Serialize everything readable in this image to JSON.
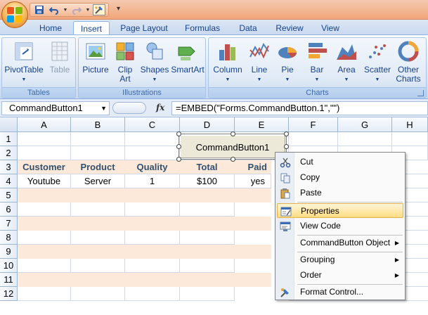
{
  "qat": {
    "save_icon": "save-icon",
    "undo_icon": "undo-icon",
    "redo_icon": "redo-icon",
    "design_mode_icon": "design-mode-icon",
    "more": "▾"
  },
  "tabs": [
    {
      "label": "Home"
    },
    {
      "label": "Insert"
    },
    {
      "label": "Page Layout"
    },
    {
      "label": "Formulas"
    },
    {
      "label": "Data"
    },
    {
      "label": "Review"
    },
    {
      "label": "View"
    }
  ],
  "ribbon": {
    "tables": {
      "label": "Tables",
      "pivot": "PivotTable",
      "table": "Table"
    },
    "illustrations": {
      "label": "Illustrations",
      "picture": "Picture",
      "clipart_1": "Clip",
      "clipart_2": "Art",
      "shapes": "Shapes",
      "smartart": "SmartArt"
    },
    "charts": {
      "label": "Charts",
      "column": "Column",
      "line": "Line",
      "pie": "Pie",
      "bar": "Bar",
      "area": "Area",
      "scatter": "Scatter",
      "other_1": "Other",
      "other_2": "Charts"
    }
  },
  "formula_bar": {
    "name_box": "CommandButton1",
    "fx": "fx",
    "formula": "=EMBED(\"Forms.CommandButton.1\",\"\")"
  },
  "grid": {
    "columns": [
      "A",
      "B",
      "C",
      "D",
      "E",
      "F",
      "G",
      "H"
    ],
    "rows": [
      "1",
      "2",
      "3",
      "4",
      "5",
      "6",
      "7",
      "8",
      "9",
      "10",
      "11",
      "12"
    ],
    "headers": [
      "Customer",
      "Product",
      "Quality",
      "Total",
      "Paid"
    ],
    "data": [
      "Youtube",
      "Server",
      "1",
      "$100",
      "yes"
    ]
  },
  "command_button": {
    "label": "CommandButton1"
  },
  "context_menu": {
    "cut": "Cut",
    "copy": "Copy",
    "paste": "Paste",
    "properties": "Properties",
    "view_code": "View Code",
    "object": "CommandButton Object",
    "grouping": "Grouping",
    "order": "Order",
    "format": "Format Control..."
  }
}
